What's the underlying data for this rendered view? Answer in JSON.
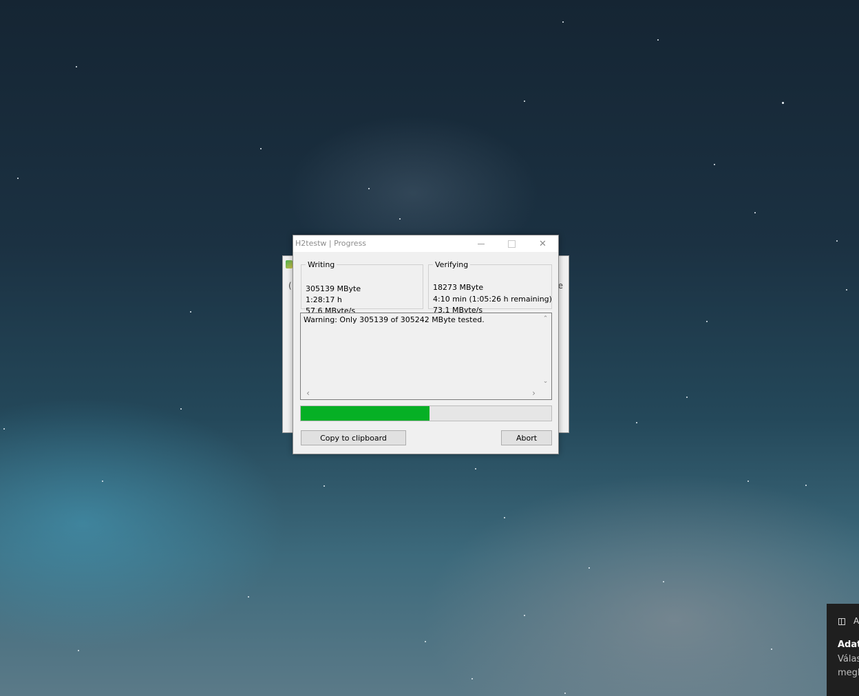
{
  "dialog": {
    "title": "H2testw | Progress",
    "writing": {
      "label": "Writing",
      "amount": "305139 MByte",
      "time": "1:28:17 h",
      "speed": "57.6 MByte/s"
    },
    "verifying": {
      "label": "Verifying",
      "amount": "18273 MByte",
      "time": "4:10 min (1:05:26 h remaining)",
      "speed": "73.1 MByte/s"
    },
    "log_text": "Warning: Only 305139 of 305242 MByte tested.",
    "progress_fraction": 0.515,
    "progress_color": "#06b025",
    "copy_label": "Copy to clipboard",
    "abort_label": "Abort",
    "close_glyph": "✕"
  },
  "background_window": {
    "left_glyph": "(",
    "right_glyph": "e"
  },
  "toast": {
    "app": "A",
    "title": "Adat",
    "line1": "Válas",
    "line2": "megl"
  }
}
